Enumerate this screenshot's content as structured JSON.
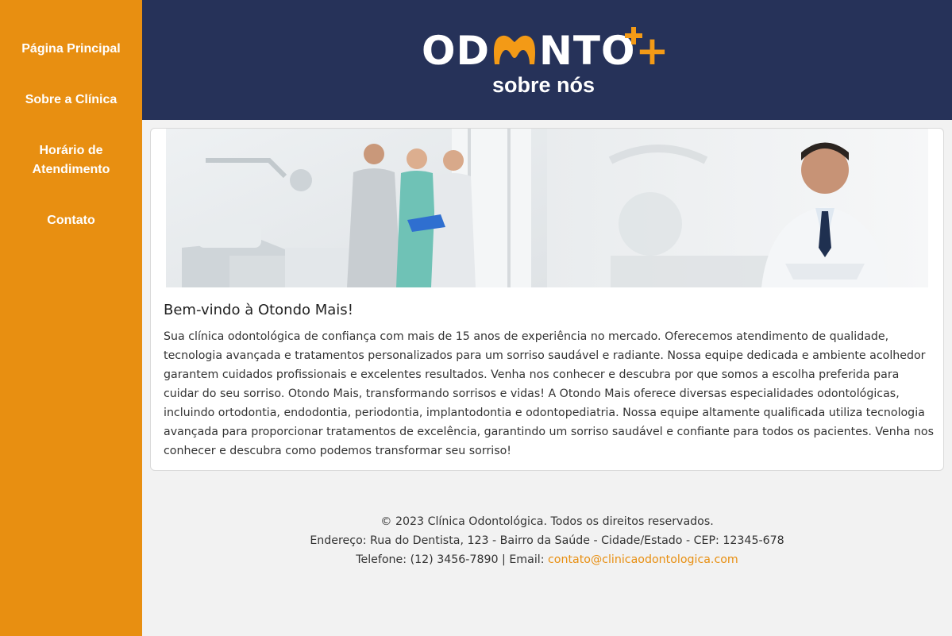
{
  "sidebar": {
    "items": [
      {
        "label": "Página Principal"
      },
      {
        "label": "Sobre a Clínica"
      },
      {
        "label": "Horário de Atendimento"
      },
      {
        "label": "Contato"
      }
    ]
  },
  "header": {
    "logo_left": "OD",
    "logo_right": "NTO",
    "logo_plus": "+",
    "subtitle": "sobre nós"
  },
  "main": {
    "title": "Bem-vindo à Otondo Mais!",
    "text": "Sua clínica odontológica de confiança com mais de 15 anos de experiência no mercado. Oferecemos atendimento de qualidade, tecnologia avançada e tratamentos personalizados para um sorriso saudável e radiante. Nossa equipe dedicada e ambiente acolhedor garantem cuidados profissionais e excelentes resultados. Venha nos conhecer e descubra por que somos a escolha preferida para cuidar do seu sorriso. Otondo Mais, transformando sorrisos e vidas! A Otondo Mais oferece diversas especialidades odontológicas, incluindo ortodontia, endodontia, periodontia, implantodontia e odontopediatria. Nossa equipe altamente qualificada utiliza tecnologia avançada para proporcionar tratamentos de excelência, garantindo um sorriso saudável e confiante para todos os pacientes. Venha nos conhecer e descubra como podemos transformar seu sorriso!"
  },
  "footer": {
    "copyright": "© 2023 Clínica Odontológica. Todos os direitos reservados.",
    "address": "Endereço: Rua do Dentista, 123 - Bairro da Saúde - Cidade/Estado - CEP: 12345-678",
    "phone_prefix": "Telefone: (12) 3456-7890 | Email: ",
    "email": "contato@clinicaodontologica.com"
  },
  "colors": {
    "sidebar": "#e88f11",
    "header": "#263259",
    "accent": "#f39a16",
    "page_bg": "#f2f2f2"
  },
  "icons": [
    "tooth-logo-icon"
  ]
}
